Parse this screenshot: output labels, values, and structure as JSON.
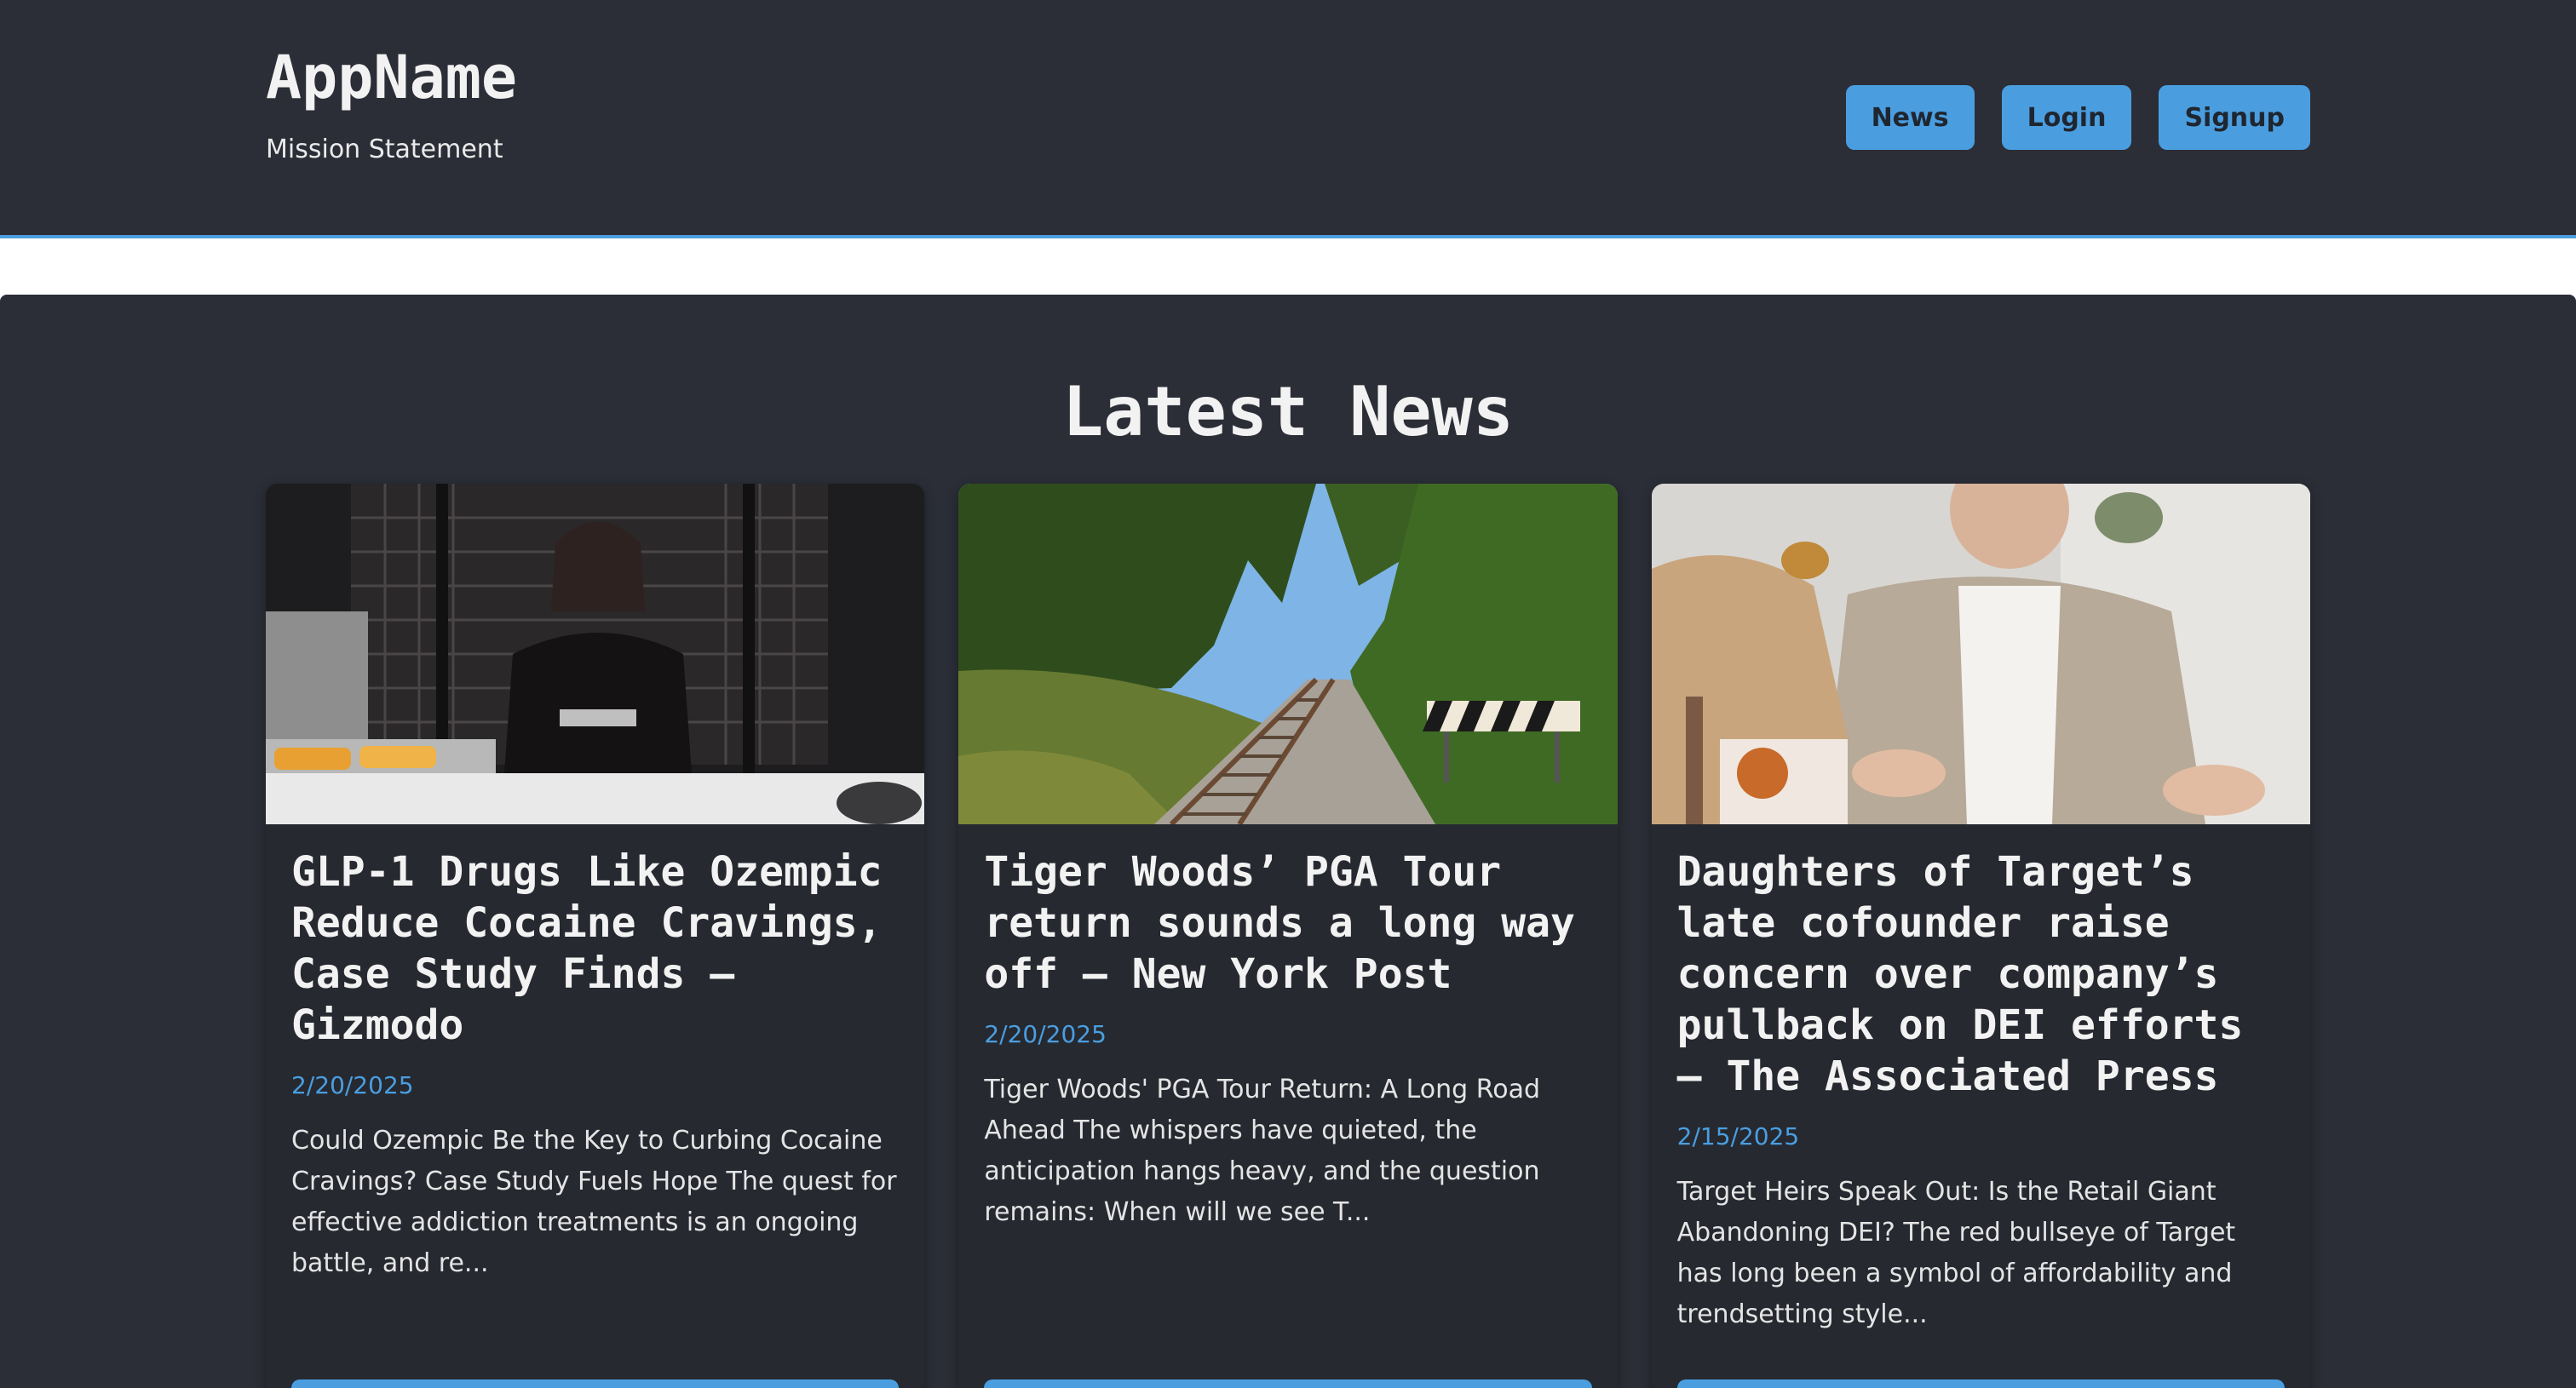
{
  "header": {
    "app_name": "AppName",
    "mission": "Mission Statement",
    "nav": [
      {
        "label": "News"
      },
      {
        "label": "Login"
      },
      {
        "label": "Signup"
      }
    ]
  },
  "main": {
    "section_title": "Latest News",
    "cards": [
      {
        "title": "GLP-1 Drugs Like Ozempic Reduce Cocaine Cravings, Case Study Finds – Gizmodo",
        "date": "2/20/2025",
        "excerpt": "Could Ozempic Be the Key to Curbing Cocaine Cravings? Case Study Fuels Hope The quest for effective addiction treatments is an ongoing battle, and re..."
      },
      {
        "title": "Tiger Woods’ PGA Tour return sounds a long way off – New York Post",
        "date": "2/20/2025",
        "excerpt": "Tiger Woods' PGA Tour Return: A Long Road Ahead The whispers have quieted, the anticipation hangs heavy, and the question remains: When will we see T..."
      },
      {
        "title": "Daughters of Target’s late cofounder raise concern over company’s pullback on DEI efforts – The Associated Press",
        "date": "2/15/2025",
        "excerpt": "Target Heirs Speak Out: Is the Retail Giant Abandoning DEI? The red bullseye of Target has long been a symbol of affordability and trendsetting style..."
      }
    ]
  },
  "colors": {
    "background": "#2b2e37",
    "card": "#262930",
    "accent": "#4a9ee0",
    "text": "#f2f2f2"
  }
}
